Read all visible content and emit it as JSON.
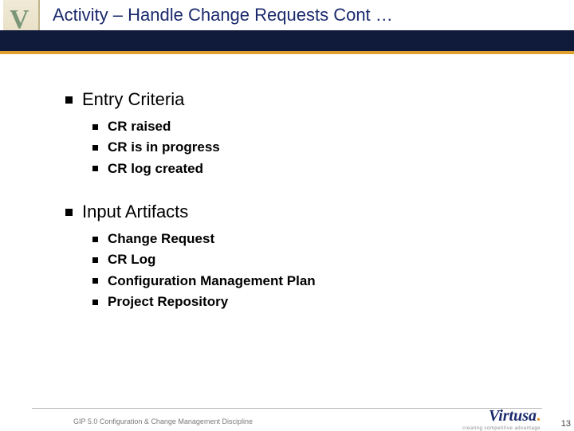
{
  "header": {
    "title": "Activity – Handle Change Requests Cont …"
  },
  "sections": {
    "s1": {
      "heading": "Entry Criteria",
      "items": {
        "i0": "CR raised",
        "i1": "CR is in progress",
        "i2": "CR log created"
      }
    },
    "s2": {
      "heading": "Input Artifacts",
      "items": {
        "i0": "Change Request",
        "i1": "CR Log",
        "i2": "Configuration Management Plan",
        "i3": "Project Repository"
      }
    }
  },
  "footer": {
    "discipline": "GIP 5.0 Configuration & Change Management Discipline",
    "logo": "Virtusa",
    "tagline": "creating competitive advantage",
    "page": "13"
  }
}
